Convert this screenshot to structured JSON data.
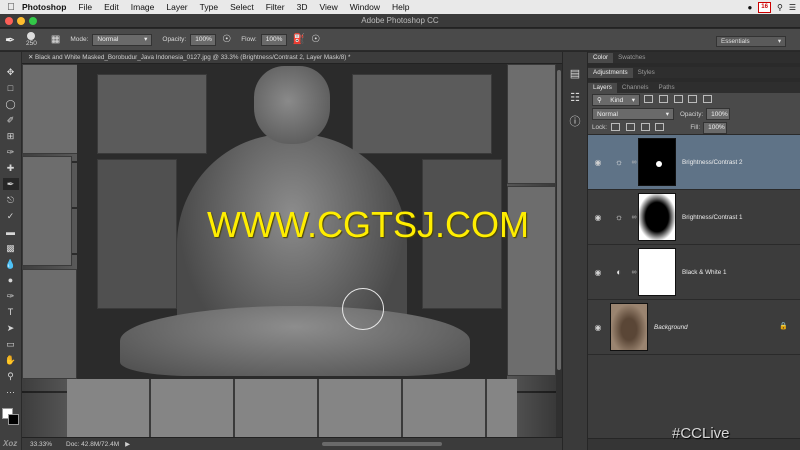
{
  "menubar": {
    "app_name": "Photoshop",
    "items": [
      "File",
      "Edit",
      "Image",
      "Layer",
      "Type",
      "Select",
      "Filter",
      "3D",
      "View",
      "Window",
      "Help"
    ],
    "calendar_day": "16"
  },
  "window": {
    "title": "Adobe Photoshop CC"
  },
  "options_bar": {
    "brush_size": "250",
    "mode_label": "Mode:",
    "mode_value": "Normal",
    "opacity_label": "Opacity:",
    "opacity_value": "100%",
    "flow_label": "Flow:",
    "flow_value": "100%",
    "workspace": "Essentials"
  },
  "document": {
    "tab_title": "Black and White Masked_Borobudur_Java Indonesia_0127.jpg @ 33.3% (Brightness/Contrast 2, Layer Mask/8) *",
    "watermark": "WWW.CGTSJ.COM",
    "zoom": "33.33%",
    "doc_info": "Doc: 42.8M/72.4M"
  },
  "panels": {
    "tabs_top": [
      "Color",
      "Swatches"
    ],
    "tabs_mid": [
      "Adjustments",
      "Styles"
    ],
    "tabs_layers": [
      "Layers",
      "Channels",
      "Paths"
    ],
    "filter_kind": "Kind",
    "blend_mode": "Normal",
    "opacity_label": "Opacity:",
    "opacity_value": "100%",
    "lock_label": "Lock:",
    "fill_label": "Fill:",
    "fill_value": "100%",
    "layers": [
      {
        "name": "Brightness/Contrast 2"
      },
      {
        "name": "Brightness/Contrast 1"
      },
      {
        "name": "Black & White 1"
      },
      {
        "name": "Background"
      }
    ]
  },
  "overlay": {
    "hashtag": "#CCLive"
  },
  "toolbar": {
    "badge": "Xoz"
  },
  "colors": {
    "active_layer": "#5f7387",
    "watermark": "#ffee00"
  }
}
